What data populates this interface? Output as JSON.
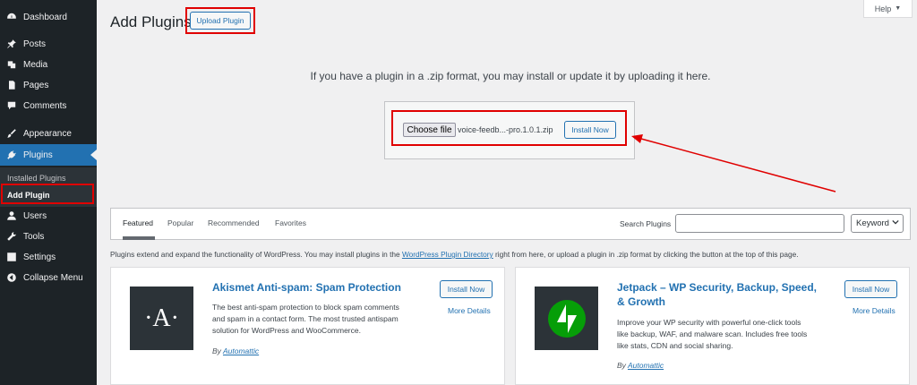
{
  "sidebar": {
    "items": [
      {
        "label": "Dashboard",
        "icon": "dashboard-icon"
      },
      {
        "label": "Posts",
        "icon": "pin-icon"
      },
      {
        "label": "Media",
        "icon": "media-icon"
      },
      {
        "label": "Pages",
        "icon": "pages-icon"
      },
      {
        "label": "Comments",
        "icon": "comment-icon"
      },
      {
        "label": "Appearance",
        "icon": "brush-icon"
      },
      {
        "label": "Plugins",
        "icon": "plug-icon"
      },
      {
        "label": "Users",
        "icon": "user-icon"
      },
      {
        "label": "Tools",
        "icon": "wrench-icon"
      },
      {
        "label": "Settings",
        "icon": "settings-icon"
      },
      {
        "label": "Collapse Menu",
        "icon": "collapse-icon"
      }
    ],
    "submenu": [
      "Installed Plugins",
      "Add Plugin"
    ]
  },
  "header": {
    "title": "Add Plugins",
    "upload_label": "Upload Plugin",
    "help_label": "Help",
    "help_arrow": "▼"
  },
  "upload": {
    "message": "If you have a plugin in a .zip format, you may install or update it by uploading it here.",
    "choose_file": "Choose file",
    "file_name": "voice-feedb...-pro.1.0.1.zip",
    "install_label": "Install Now"
  },
  "filters": {
    "tabs": [
      "Featured",
      "Popular",
      "Recommended",
      "Favorites"
    ],
    "search_label": "Search Plugins",
    "search_value": "",
    "search_type": "Keyword"
  },
  "intro": {
    "before": "Plugins extend and expand the functionality of WordPress. You may install plugins in the ",
    "link": "WordPress Plugin Directory",
    "after": " right from here, or upload a plugin in .zip format by clicking the button at the top of this page."
  },
  "cards": [
    {
      "title": "Akismet Anti-spam: Spam Protection",
      "desc": [
        "The best anti-spam protection to block spam comments",
        "and spam in a contact form. The most trusted antispam",
        "solution for WordPress and WooCommerce."
      ],
      "by": "By",
      "author": "Automattic",
      "install": "Install Now",
      "more": "More Details",
      "icon_text": "·A·",
      "icon_bg": "#2c3338"
    },
    {
      "title_lines": [
        "Jetpack – WP Security, Backup, Speed,",
        "& Growth"
      ],
      "desc": [
        "Improve your WP security with powerful one-click tools",
        "like backup, WAF, and malware scan. Includes free tools",
        "like stats, CDN and social sharing."
      ],
      "by": "By",
      "author": "Automattic",
      "install": "Install Now",
      "more": "More Details",
      "icon_bg": "#2c3338",
      "icon_accent": "#069e08"
    }
  ],
  "colors": {
    "accent": "#2271b1",
    "sidebar": "#1d2327",
    "highlight": "#e00000"
  }
}
